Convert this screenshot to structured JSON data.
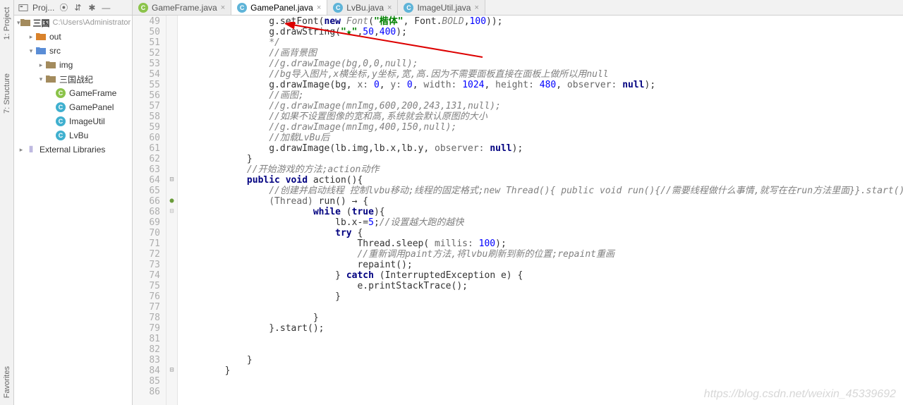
{
  "sidebars": {
    "project": "1: Project",
    "structure": "7: Structure",
    "favorites": "Favorites"
  },
  "toolbar": {
    "label": "Proj..."
  },
  "tabs": [
    {
      "label": "GameFrame.java",
      "icon": "g"
    },
    {
      "label": "GamePanel.java",
      "icon": "c",
      "active": true
    },
    {
      "label": "LvBu.java",
      "icon": "c"
    },
    {
      "label": "ImageUtil.java",
      "icon": "c"
    }
  ],
  "tree": {
    "root": {
      "name": "三国",
      "path": " C:\\Users\\Administrator"
    },
    "out": "out",
    "src": "src",
    "img": "img",
    "pkg": "三国战纪",
    "cls": [
      "GameFrame",
      "GamePanel",
      "ImageUtil",
      "LvBu"
    ],
    "ext": "External Libraries"
  },
  "lines": {
    "start": 49,
    "end": 86,
    "49": [
      "                g.setFont(",
      [
        "k",
        "new"
      ],
      [
        "p",
        " "
      ],
      [
        "c",
        "Font"
      ],
      "(",
      [
        "s",
        "\"楷体\""
      ],
      ", Font.",
      [
        "c",
        "BOLD"
      ],
      ",",
      [
        "n",
        "100"
      ],
      "));"
    ],
    "50": [
      "                g.drawString(",
      [
        "s",
        "\"★\""
      ],
      ",",
      [
        "n",
        "50"
      ],
      ",",
      [
        "n",
        "400"
      ],
      ");"
    ],
    "51": [
      [
        "c",
        "                */"
      ]
    ],
    "52": [
      [
        "c",
        "                //画背景图"
      ]
    ],
    "53": [
      [
        "c",
        "                //g.drawImage(bg,0,0,null);"
      ]
    ],
    "54": [
      [
        "c",
        "                //bg导入图片,x横坐标,y坐标,宽,高.因为不需要面板直接在面板上做所以用null"
      ]
    ],
    "55": [
      "                g.drawImage(bg, ",
      [
        "p",
        "x: "
      ],
      [
        "n",
        "0"
      ],
      ", ",
      [
        "p",
        "y: "
      ],
      [
        "n",
        "0"
      ],
      ", ",
      [
        "p",
        "width: "
      ],
      [
        "n",
        "1024"
      ],
      ", ",
      [
        "p",
        "height: "
      ],
      [
        "n",
        "480"
      ],
      ", ",
      [
        "p",
        "observer: "
      ],
      [
        "k",
        "null"
      ],
      ");"
    ],
    "56": [
      [
        "c",
        "                //画图;"
      ]
    ],
    "57": [
      [
        "c",
        "                //g.drawImage(mnImg,600,200,243,131,null);"
      ]
    ],
    "58": [
      [
        "c",
        "                //如果不设置图像的宽和高,系统就会默认原图的大小"
      ]
    ],
    "59": [
      [
        "c",
        "                //g.drawImage(mnImg,400,150,null);"
      ]
    ],
    "60": [
      [
        "c",
        "                //加载LvBu后"
      ]
    ],
    "61": [
      "                g.drawImage(lb.img,lb.x,lb.y, ",
      [
        "p",
        "observer: "
      ],
      [
        "k",
        "null"
      ],
      ");"
    ],
    "62": [
      "            }"
    ],
    "63": [
      [
        "c",
        "            //开始游戏的方法;action动作"
      ]
    ],
    "64": [
      "            ",
      [
        "k",
        "public void"
      ],
      " action(){"
    ],
    "65": [
      [
        "c",
        "                //创建并启动线程 控制lvbu移动;线程的固定格式;new Thread(){ public void run(){//需要线程做什么事情,就写在在run方法里面}}.start();"
      ]
    ],
    "66": [
      "                ",
      [
        "p",
        "(Thread)"
      ],
      " run() → {"
    ],
    "68": [
      "                        ",
      [
        "k",
        "while"
      ],
      " (",
      [
        "k",
        "true"
      ],
      "){"
    ],
    "69": [
      "                            lb.x-=",
      [
        "n",
        "5"
      ],
      ";",
      [
        "c",
        "//设置越大跑的越快"
      ]
    ],
    "70": [
      "                            ",
      [
        "k",
        "try"
      ],
      " {"
    ],
    "71": [
      "                                Thread.sleep( ",
      [
        "p",
        "millis: "
      ],
      [
        "n",
        "100"
      ],
      ");"
    ],
    "72": [
      [
        "c",
        "                                //重新调用paint方法,将lvbu刷新到新的位置;repaint重画"
      ]
    ],
    "73": [
      "                                repaint();"
    ],
    "74": [
      "                            } ",
      [
        "k",
        "catch"
      ],
      " (InterruptedException e) {"
    ],
    "75": [
      "                                e.printStackTrace();"
    ],
    "76": [
      "                            }"
    ],
    "77": [
      ""
    ],
    "78": [
      "                        }"
    ],
    "79": [
      "                }.start();"
    ],
    "81": [
      ""
    ],
    "82": [
      ""
    ],
    "83": [
      "            }"
    ],
    "84": [
      "        }"
    ],
    "85": [
      "        "
    ],
    "86": [
      ""
    ]
  },
  "lineOrder": [
    49,
    50,
    51,
    52,
    53,
    54,
    55,
    56,
    57,
    58,
    59,
    60,
    61,
    62,
    63,
    64,
    65,
    66,
    68,
    69,
    70,
    71,
    72,
    73,
    74,
    75,
    76,
    77,
    78,
    79,
    81,
    82,
    83,
    84,
    85,
    86
  ],
  "watermark": "https://blog.csdn.net/weixin_45339692"
}
